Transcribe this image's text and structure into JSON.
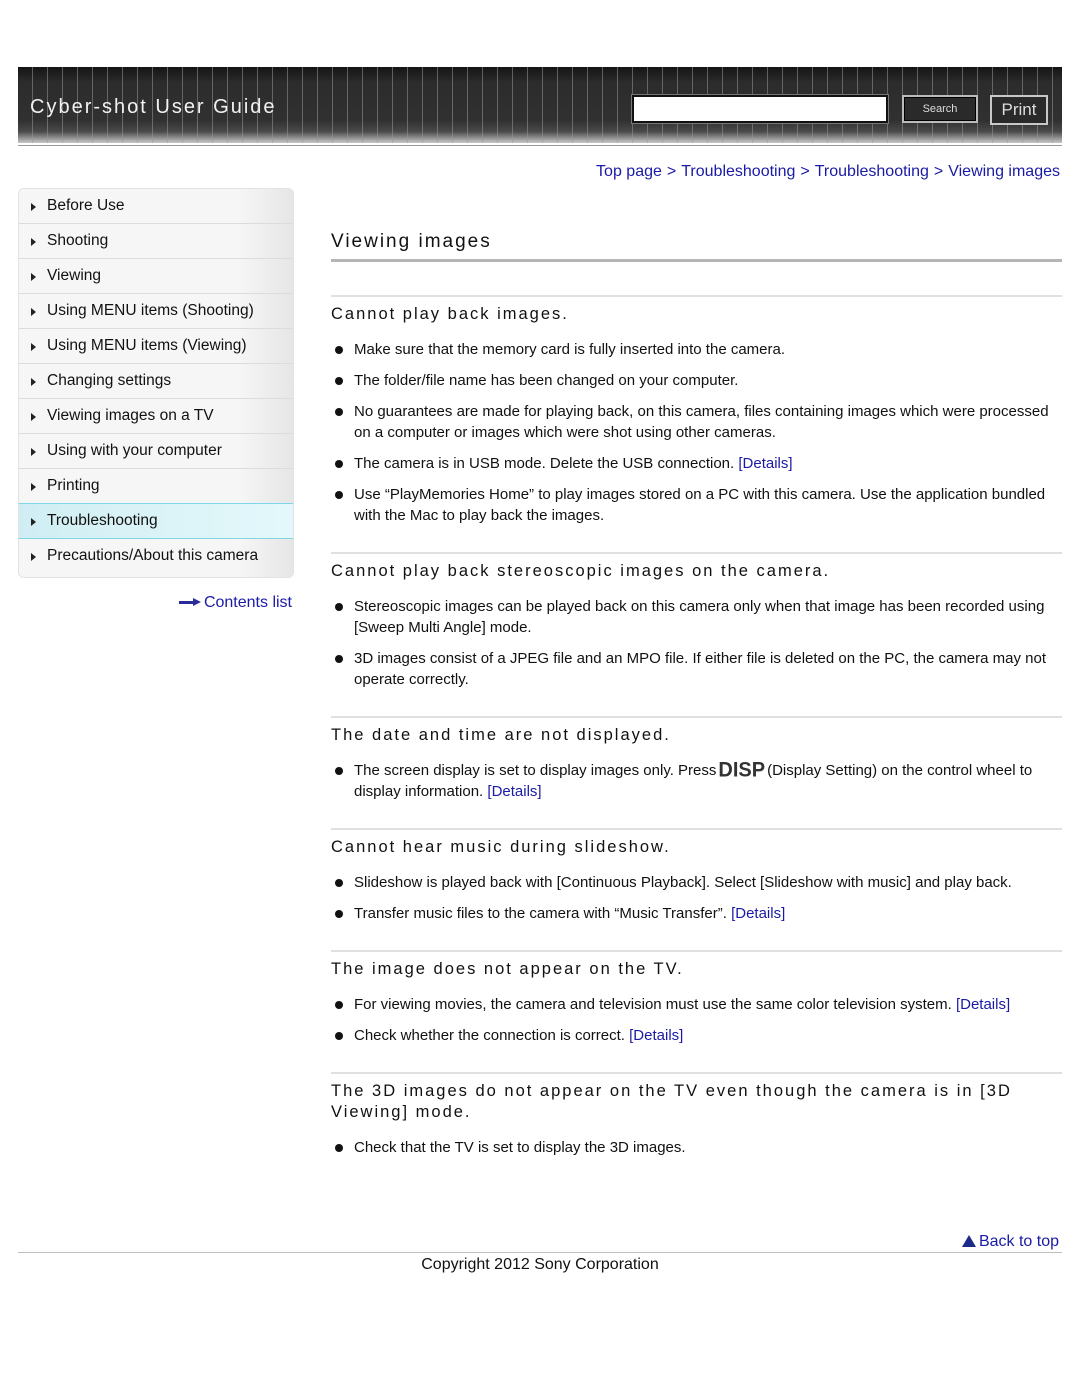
{
  "header": {
    "title": "Cyber-shot User Guide",
    "search_placeholder": "",
    "search_value": "",
    "search_label": "Search",
    "print_label": "Print"
  },
  "breadcrumb": [
    "Top page",
    "Troubleshooting",
    "Troubleshooting",
    "Viewing images"
  ],
  "breadcrumb_sep": ">",
  "sidebar": {
    "items": [
      {
        "label": "Before Use",
        "active": false
      },
      {
        "label": "Shooting",
        "active": false
      },
      {
        "label": "Viewing",
        "active": false
      },
      {
        "label": "Using MENU items (Shooting)",
        "active": false
      },
      {
        "label": "Using MENU items (Viewing)",
        "active": false
      },
      {
        "label": "Changing settings",
        "active": false
      },
      {
        "label": "Viewing images on a TV",
        "active": false
      },
      {
        "label": "Using with your computer",
        "active": false
      },
      {
        "label": "Printing",
        "active": false
      },
      {
        "label": "Troubleshooting",
        "active": true
      },
      {
        "label": "Precautions/About this camera",
        "active": false
      }
    ],
    "contents_link": "Contents list"
  },
  "main": {
    "title": "Viewing images",
    "sections": [
      {
        "title": "Cannot play back images.",
        "items": [
          {
            "text": "Make sure that the memory card is fully inserted into the camera."
          },
          {
            "text": "The folder/file name has been changed on your computer."
          },
          {
            "text": "No guarantees are made for playing back, on this camera, files containing images which were processed on a computer or images which were shot using other cameras."
          },
          {
            "text": "The camera is in USB mode. Delete the USB connection.",
            "link": "[Details]"
          },
          {
            "text": "Use “PlayMemories Home” to play images stored on a PC with this camera. Use the application bundled with the Mac to play back the images."
          }
        ]
      },
      {
        "title": "Cannot play back stereoscopic images on the camera.",
        "items": [
          {
            "text": "Stereoscopic images can be played back on this camera only when that image has been recorded using [Sweep Multi Angle] mode."
          },
          {
            "text": "3D images consist of a JPEG file and an MPO file. If either file is deleted on the PC, the camera may not operate correctly."
          }
        ]
      },
      {
        "title": "The date and time are not displayed.",
        "items": [
          {
            "text_before": "The screen display is set to display images only. Press",
            "icon": "DISP",
            "text_after": "(Display Setting) on the control wheel to display information.",
            "link": "[Details]"
          }
        ]
      },
      {
        "title": "Cannot hear music during slideshow.",
        "items": [
          {
            "text": "Slideshow is played back with [Continuous Playback]. Select [Slideshow with music] and play back."
          },
          {
            "text": "Transfer music files to the camera with “Music Transfer”.",
            "link": "[Details]"
          }
        ]
      },
      {
        "title": "The image does not appear on the TV.",
        "items": [
          {
            "text": "For viewing movies, the camera and television must use the same color television system.",
            "link": "[Details]"
          },
          {
            "text": "Check whether the connection is correct.",
            "link": "[Details]"
          }
        ]
      },
      {
        "title": "The 3D images do not appear on the TV even though the camera is in [3D Viewing] mode.",
        "items": [
          {
            "text": "Check that the TV is set to display the 3D images."
          }
        ]
      }
    ]
  },
  "footer": {
    "back_to_top": "Back to top",
    "copyright": "Copyright 2012 Sony Corporation"
  },
  "colors": {
    "link": "#1a1aa6",
    "active_nav": "#d9f2f6",
    "header_bg": "#2c2c2c"
  }
}
